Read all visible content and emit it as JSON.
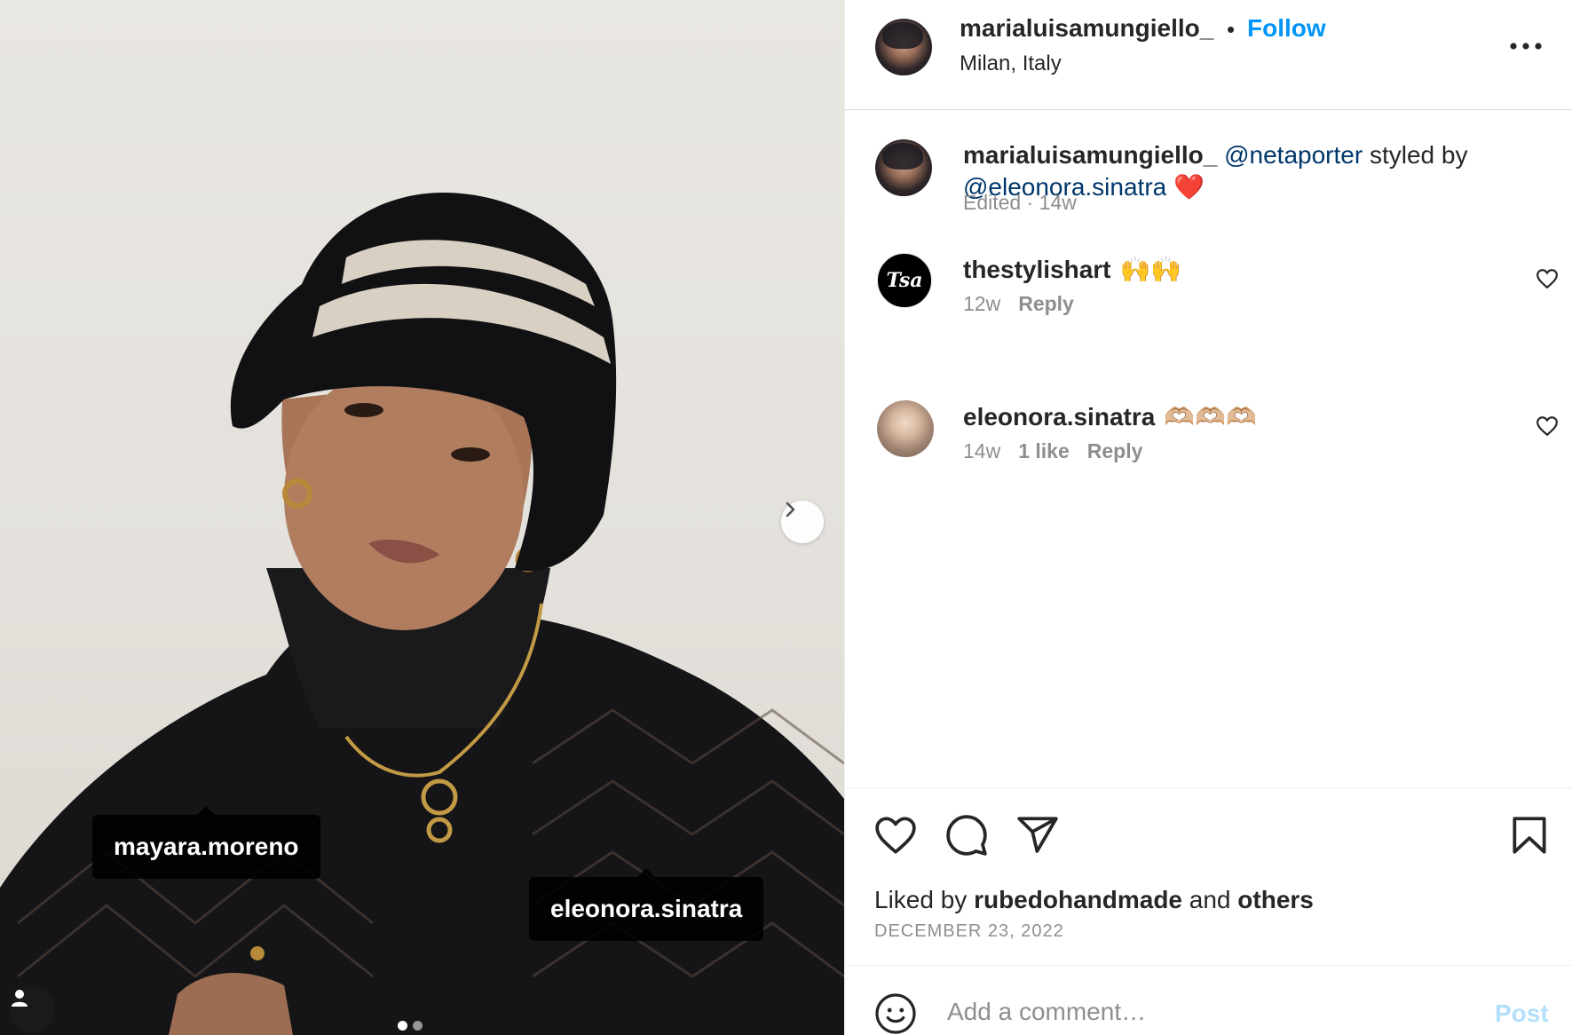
{
  "post": {
    "author": "marialuisamungiello_",
    "location": "Milan, Italy",
    "follow_label": "Follow",
    "separator": "•"
  },
  "photo": {
    "tags": [
      "mayara.moreno",
      "eleonora.sinatra"
    ],
    "carousel": {
      "current": 1,
      "total": 2
    }
  },
  "caption": {
    "username": "marialuisamungiello_",
    "mention_1": "@netaporter",
    "text_mid": " styled by ",
    "mention_2": "@eleonora.sinatra",
    "emoji": "❤️",
    "meta": "Edited · 14w"
  },
  "comments": [
    {
      "username": "thestylishart",
      "text": "🙌🙌",
      "time": "12w",
      "likes": "",
      "reply": "Reply",
      "avatar_text": "Tsa"
    },
    {
      "username": "eleonora.sinatra",
      "text": "🫶🏼🫶🏼🫶🏼",
      "time": "14w",
      "likes": "1 like",
      "reply": "Reply"
    }
  ],
  "actions": {
    "liked_by_prefix": "Liked by ",
    "liked_by_user": "rubedohandmade",
    "liked_by_mid": " and ",
    "liked_by_suffix": "others",
    "date": "DECEMBER 23, 2022"
  },
  "composer": {
    "placeholder": "Add a comment…",
    "post_label": "Post"
  },
  "colors": {
    "accent": "#0095f6",
    "mention": "#00376b",
    "muted": "#8e8e8e",
    "post_disabled": "#b2dffc"
  }
}
